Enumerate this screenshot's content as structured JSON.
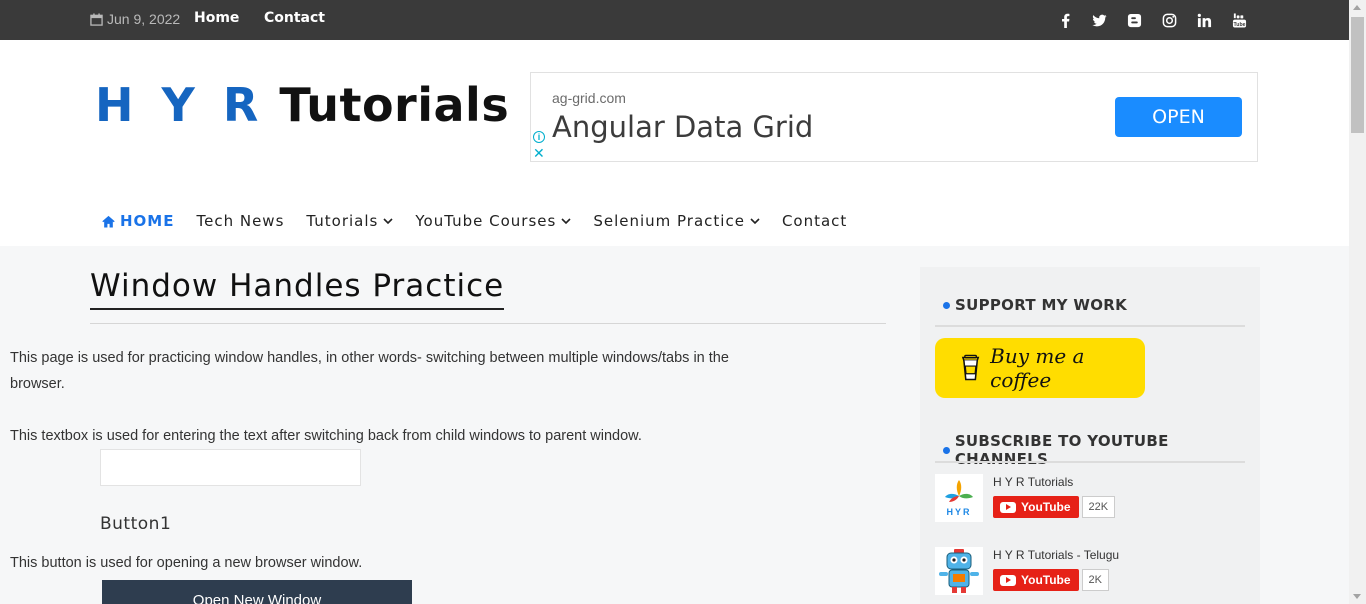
{
  "topbar": {
    "date": "Jun 9, 2022",
    "links": [
      "Home",
      "Contact"
    ],
    "social_icons": [
      "facebook-icon",
      "twitter-icon",
      "blogger-icon",
      "instagram-icon",
      "linkedin-icon",
      "youtube-icon"
    ]
  },
  "header": {
    "logo_hyr": "H Y R",
    "logo_tutorials": "Tutorials"
  },
  "ad": {
    "domain": "ag-grid.com",
    "headline": "Angular Data Grid",
    "cta": "OPEN",
    "info": "i",
    "close": "✕"
  },
  "nav": {
    "home": "HOME",
    "tech_news": "Tech News",
    "tutorials": "Tutorials",
    "youtube_courses": "YouTube Courses",
    "selenium_practice": "Selenium Practice",
    "contact": "Contact"
  },
  "main": {
    "title": "Window Handles Practice",
    "intro": "This page is used for practicing window handles, in other words- switching between multiple windows/tabs in the browser.",
    "textbox_desc": "This textbox is used for entering the text after switching back from child windows to parent window.",
    "textbox_value": "",
    "button1_heading": "Button1",
    "button1_desc": "This button is used for opening a new browser window.",
    "button1_label": "Open New Window"
  },
  "sidebar": {
    "support_title": "SUPPORT MY WORK",
    "coffee_label": "Buy me a coffee",
    "subscribe_title": "SUBSCRIBE TO YOUTUBE CHANNELS",
    "channels": [
      {
        "name": "H Y R Tutorials",
        "button": "YouTube",
        "count": "22K"
      },
      {
        "name": "H Y R Tutorials - Telugu",
        "button": "YouTube",
        "count": "2K"
      }
    ]
  },
  "colors": {
    "topbar_bg": "#3a3a3a",
    "accent_blue": "#1a73e8",
    "ad_button": "#1a8cff",
    "coffee_yellow": "#ffdd00",
    "youtube_red": "#e62117",
    "open_window_button": "#2e3d4f"
  }
}
